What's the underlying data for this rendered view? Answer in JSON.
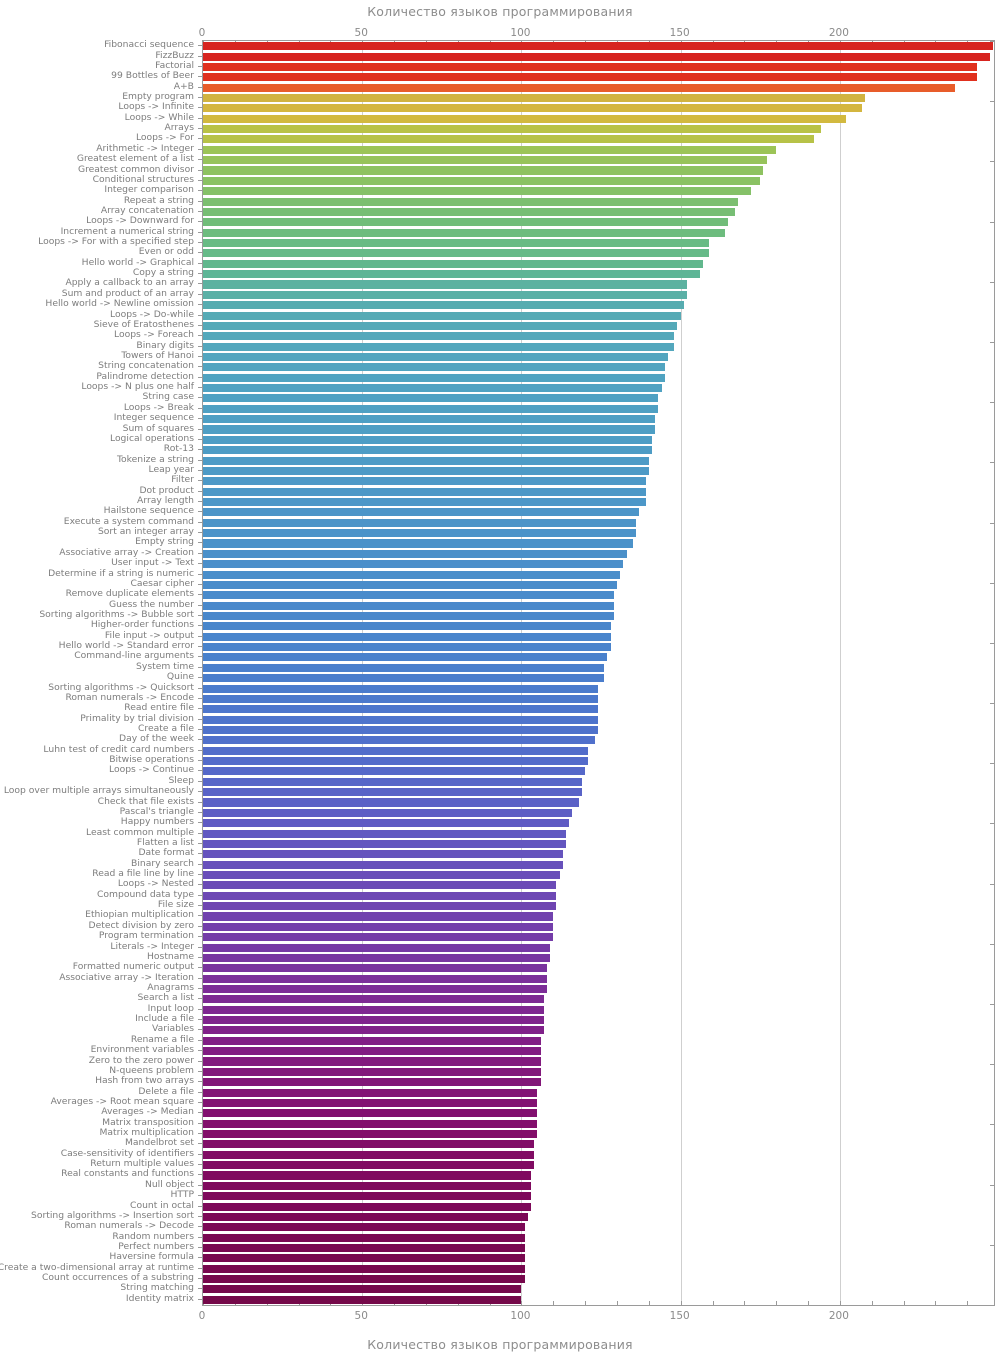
{
  "titles": {
    "top": "Количество языков программирования",
    "bottom": "Количество языков программирования"
  },
  "axis": {
    "ticks": [
      {
        "label": "0",
        "value": 0
      },
      {
        "label": "50",
        "value": 50
      },
      {
        "label": "100",
        "value": 100
      },
      {
        "label": "150",
        "value": 150
      },
      {
        "label": "200",
        "value": 200
      }
    ],
    "minor_step": 10,
    "xmin": 0,
    "xmax": 248.4
  },
  "chart_data": {
    "type": "bar",
    "orientation": "horizontal",
    "title": "Количество языков программирования",
    "xlabel": "Количество языков программирования",
    "ylabel": "",
    "xlim": [
      0,
      248.4
    ],
    "grid": true,
    "legend": "none",
    "categories": [
      "Fibonacci sequence",
      "FizzBuzz",
      "Factorial",
      "99 Bottles of Beer",
      "A+B",
      "Empty program",
      "Loops -> Infinite",
      "Loops -> While",
      "Arrays",
      "Loops -> For",
      "Arithmetic -> Integer",
      "Greatest element of a list",
      "Greatest common divisor",
      "Conditional structures",
      "Integer comparison",
      "Repeat a string",
      "Array concatenation",
      "Loops -> Downward for",
      "Increment a numerical string",
      "Loops -> For with a specified step",
      "Even or odd",
      "Hello world -> Graphical",
      "Copy a string",
      "Apply a callback to an array",
      "Sum and product of an array",
      "Hello world -> Newline omission",
      "Loops -> Do-while",
      "Sieve of Eratosthenes",
      "Loops -> Foreach",
      "Binary digits",
      "Towers of Hanoi",
      "String concatenation",
      "Palindrome detection",
      "Loops -> N plus one half",
      "String case",
      "Loops -> Break",
      "Integer sequence",
      "Sum of squares",
      "Logical operations",
      "Rot-13",
      "Tokenize a string",
      "Leap year",
      "Filter",
      "Dot product",
      "Array length",
      "Hailstone sequence",
      "Execute a system command",
      "Sort an integer array",
      "Empty string",
      "Associative array -> Creation",
      "User input -> Text",
      "Determine if a string is numeric",
      "Caesar cipher",
      "Remove duplicate elements",
      "Guess the number",
      "Sorting algorithms -> Bubble sort",
      "Higher-order functions",
      "File input -> output",
      "Hello world -> Standard error",
      "Command-line arguments",
      "System time",
      "Quine",
      "Sorting algorithms -> Quicksort",
      "Roman numerals -> Encode",
      "Read entire file",
      "Primality by trial division",
      "Create a file",
      "Day of the week",
      "Luhn test of credit card numbers",
      "Bitwise operations",
      "Loops -> Continue",
      "Sleep",
      "Loop over multiple arrays simultaneously",
      "Check that file exists",
      "Pascal's triangle",
      "Happy numbers",
      "Least common multiple",
      "Flatten a list",
      "Date format",
      "Binary search",
      "Read a file line by line",
      "Loops -> Nested",
      "Compound data type",
      "File size",
      "Ethiopian multiplication",
      "Detect division by zero",
      "Program termination",
      "Literals -> Integer",
      "Hostname",
      "Formatted numeric output",
      "Associative array -> Iteration",
      "Anagrams",
      "Search a list",
      "Input loop",
      "Include a file",
      "Variables",
      "Rename a file",
      "Environment variables",
      "Zero to the zero power",
      "N-queens problem",
      "Hash from two arrays",
      "Delete a file",
      "Averages -> Root mean square",
      "Averages -> Median",
      "Matrix transposition",
      "Matrix multiplication",
      "Mandelbrot set",
      "Case-sensitivity of identifiers",
      "Return multiple values",
      "Real constants and functions",
      "Null object",
      "HTTP",
      "Count in octal",
      "Sorting algorithms -> Insertion sort",
      "Roman numerals -> Decode",
      "Random numbers",
      "Perfect numbers",
      "Haversine formula",
      "Create a two-dimensional array at runtime",
      "Count occurrences of a substring",
      "String matching",
      "Identity matrix"
    ],
    "values": [
      248,
      247,
      243,
      243,
      236,
      208,
      207,
      202,
      194,
      192,
      180,
      177,
      176,
      175,
      172,
      168,
      167,
      165,
      164,
      159,
      159,
      157,
      156,
      152,
      152,
      151,
      150,
      149,
      148,
      148,
      146,
      145,
      145,
      144,
      143,
      143,
      142,
      142,
      141,
      141,
      140,
      140,
      139,
      139,
      139,
      137,
      136,
      136,
      135,
      133,
      132,
      131,
      130,
      129,
      129,
      129,
      128,
      128,
      128,
      127,
      126,
      126,
      124,
      124,
      124,
      124,
      124,
      123,
      121,
      121,
      120,
      119,
      119,
      118,
      116,
      115,
      114,
      114,
      113,
      113,
      112,
      111,
      111,
      111,
      110,
      110,
      110,
      109,
      109,
      108,
      108,
      108,
      107,
      107,
      107,
      107,
      106,
      106,
      106,
      106,
      106,
      105,
      105,
      105,
      105,
      105,
      104,
      104,
      104,
      103,
      103,
      103,
      103,
      102,
      101,
      101,
      101,
      101,
      101,
      101,
      100,
      100,
      100
    ],
    "colors": [
      "#d7241f",
      "#d7241f",
      "#e0301e",
      "#e0301e",
      "#e85c2a",
      "#d1b340",
      "#d4b63f",
      "#d2b93f",
      "#b9c246",
      "#b7c247",
      "#9cc457",
      "#97c35b",
      "#8ec260",
      "#8ac263",
      "#85c168",
      "#7cbf70",
      "#77be74",
      "#71bd79",
      "#6dbc7e",
      "#68bb84",
      "#66ba88",
      "#61b78d",
      "#5eb596",
      "#5cb2a0",
      "#5bb0a6",
      "#57acb0",
      "#56aab5",
      "#55a9b8",
      "#54a8bb",
      "#53a7bd",
      "#52a5bf",
      "#51a4c0",
      "#50a3c1",
      "#50a2c2",
      "#4fa1c3",
      "#4fa0c3",
      "#4e9fc4",
      "#4e9ec4",
      "#4d9dc5",
      "#4d9cc5",
      "#4d9bc6",
      "#4d9ac6",
      "#4d99c7",
      "#4c98c7",
      "#4c97c8",
      "#4c95c8",
      "#4c94c8",
      "#4b93c9",
      "#4b92c9",
      "#4b90c9",
      "#4b8fca",
      "#4a8eca",
      "#4a8cca",
      "#4a8bcb",
      "#4a89cb",
      "#4a88cb",
      "#4986cb",
      "#4985cc",
      "#4983cc",
      "#4981cc",
      "#4a7fcc",
      "#4a7dcc",
      "#4b7bcc",
      "#4c79cc",
      "#4d76cc",
      "#4e74cc",
      "#4f72cb",
      "#5070cb",
      "#526dca",
      "#536bca",
      "#5568c9",
      "#5766c8",
      "#5963c7",
      "#5b61c6",
      "#5d5ec4",
      "#5f5bc3",
      "#6159c1",
      "#6356bf",
      "#6553bd",
      "#6750bb",
      "#694eb9",
      "#6b4bb6",
      "#6d48b4",
      "#6f45b1",
      "#7142ae",
      "#733fab",
      "#743ca8",
      "#7639a5",
      "#7836a1",
      "#79339e",
      "#7b309a",
      "#7c2d97",
      "#7d2a93",
      "#7e2790",
      "#7f248c",
      "#802189",
      "#811e85",
      "#811c82",
      "#821a7e",
      "#82187b",
      "#821678",
      "#821475",
      "#821272",
      "#82106f",
      "#820f6c",
      "#820e69",
      "#810d67",
      "#810c64",
      "#800b62",
      "#800a5f",
      "#7f0a5d",
      "#7e095b",
      "#7d0959",
      "#7c0857",
      "#7b0855",
      "#7a0853",
      "#790851",
      "#78084f",
      "#77084e",
      "#76084c",
      "#75084b",
      "#740849",
      "#730848"
    ]
  }
}
